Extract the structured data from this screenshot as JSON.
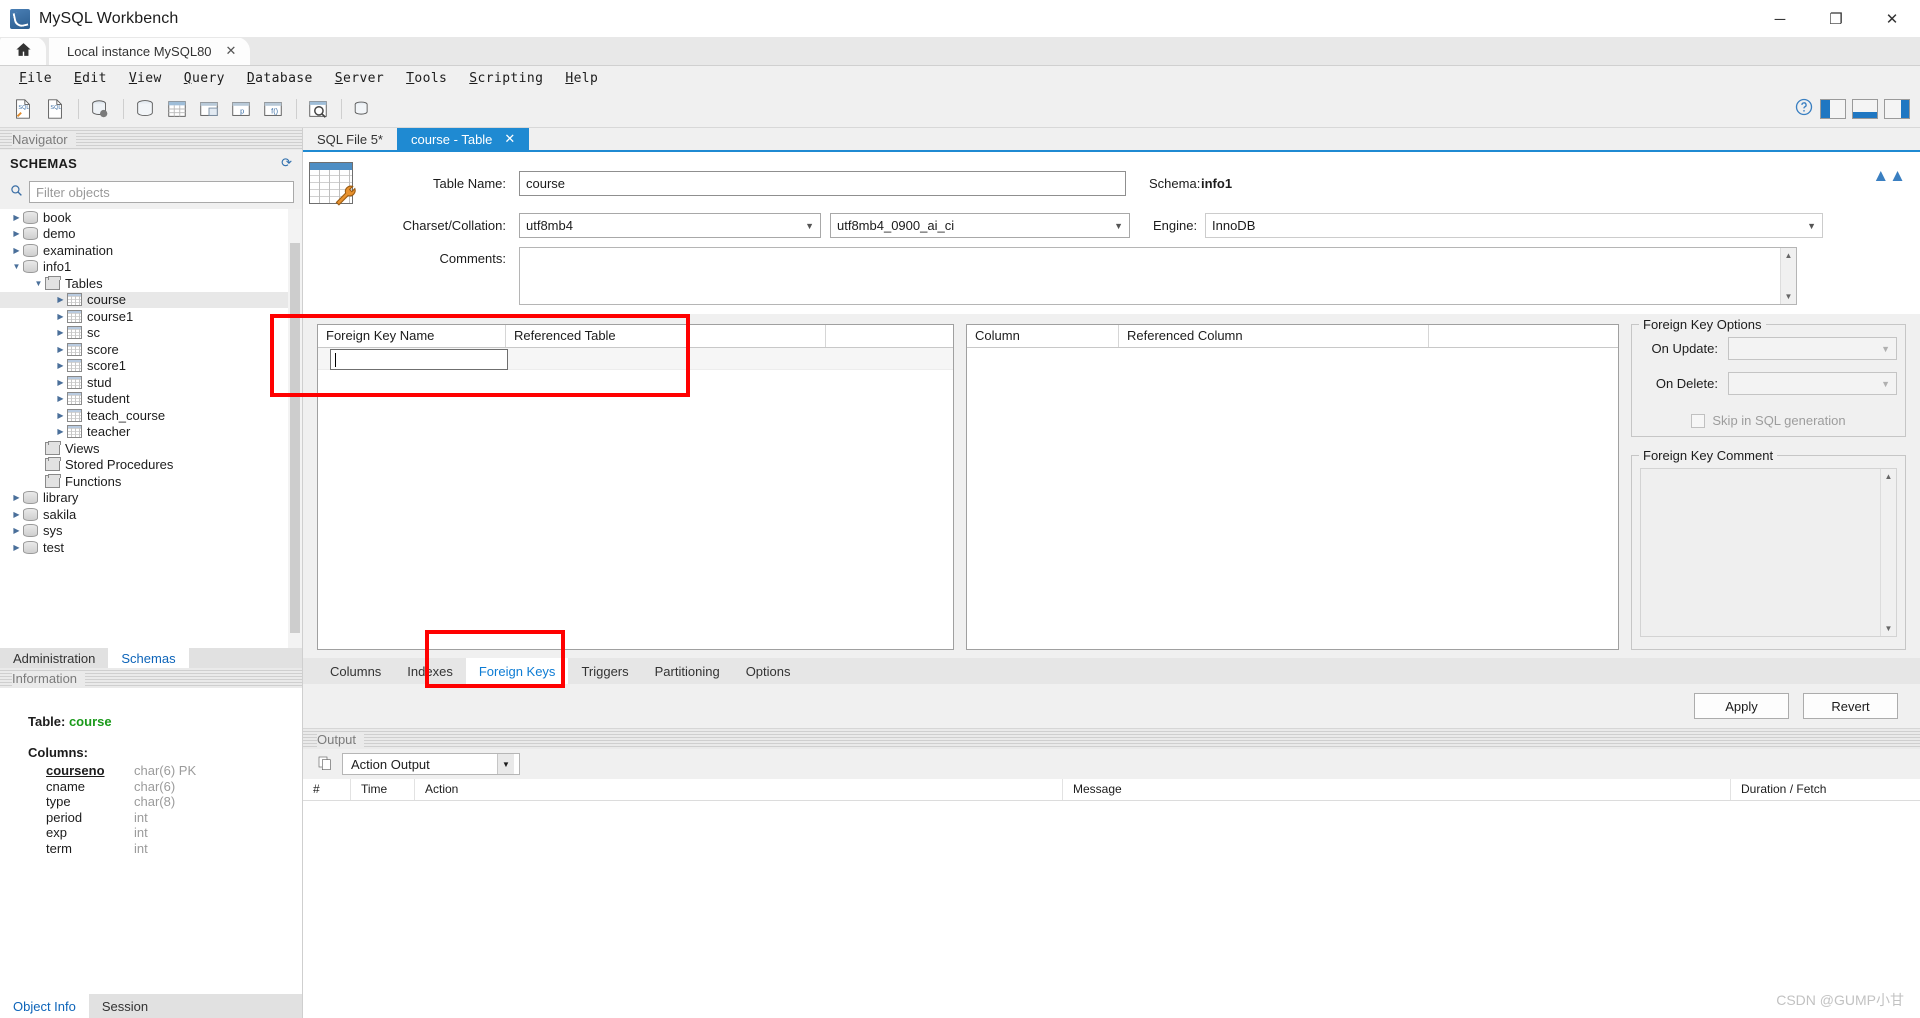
{
  "window": {
    "title": "MySQL Workbench",
    "app_icon": "mysql-dolphin-icon",
    "minimize": "─",
    "maximize": "❐",
    "close": "✕"
  },
  "connection_tabs": {
    "home_icon": "home-icon",
    "tabs": [
      {
        "label": "Local instance MySQL80",
        "close": "✕",
        "active": true
      }
    ]
  },
  "menubar": {
    "items": [
      "File",
      "Edit",
      "View",
      "Query",
      "Database",
      "Server",
      "Tools",
      "Scripting",
      "Help"
    ]
  },
  "toolbar": {
    "buttons": [
      "new-sql-tab-icon",
      "open-sql-script-icon",
      "open-connection-icon",
      "new-schema-icon",
      "new-table-icon",
      "new-view-icon",
      "new-procedure-icon",
      "new-function-icon",
      "search-data-icon",
      "reconnect-server-icon"
    ],
    "right_buttons": [
      "help-icon",
      "sidebar-toggle-icon",
      "output-toggle-icon",
      "secondary-sidebar-toggle-icon"
    ]
  },
  "sidebar": {
    "navigator_title": "Navigator",
    "pin_icon": "pin-icon",
    "schemas_title": "SCHEMAS",
    "refresh_icon": "refresh-icon",
    "filter": {
      "placeholder": "Filter objects",
      "value": "",
      "icon": "search-icon"
    },
    "tree": [
      {
        "label": "book",
        "indent": 0,
        "type": "schema",
        "expanded": false,
        "selected": false
      },
      {
        "label": "demo",
        "indent": 0,
        "type": "schema",
        "expanded": false,
        "selected": false
      },
      {
        "label": "examination",
        "indent": 0,
        "type": "schema",
        "expanded": false,
        "selected": false
      },
      {
        "label": "info1",
        "indent": 0,
        "type": "schema",
        "expanded": true,
        "selected": false
      },
      {
        "label": "Tables",
        "indent": 1,
        "type": "group",
        "expanded": true,
        "selected": false
      },
      {
        "label": "course",
        "indent": 2,
        "type": "table",
        "expanded": false,
        "selected": true
      },
      {
        "label": "course1",
        "indent": 2,
        "type": "table",
        "expanded": false,
        "selected": false
      },
      {
        "label": "sc",
        "indent": 2,
        "type": "table",
        "expanded": false,
        "selected": false
      },
      {
        "label": "score",
        "indent": 2,
        "type": "table",
        "expanded": false,
        "selected": false
      },
      {
        "label": "score1",
        "indent": 2,
        "type": "table",
        "expanded": false,
        "selected": false
      },
      {
        "label": "stud",
        "indent": 2,
        "type": "table",
        "expanded": false,
        "selected": false
      },
      {
        "label": "student",
        "indent": 2,
        "type": "table",
        "expanded": false,
        "selected": false
      },
      {
        "label": "teach_course",
        "indent": 2,
        "type": "table",
        "expanded": false,
        "selected": false
      },
      {
        "label": "teacher",
        "indent": 2,
        "type": "table",
        "expanded": false,
        "selected": false
      },
      {
        "label": "Views",
        "indent": 1,
        "type": "group",
        "expanded": null,
        "selected": false
      },
      {
        "label": "Stored Procedures",
        "indent": 1,
        "type": "group",
        "expanded": null,
        "selected": false
      },
      {
        "label": "Functions",
        "indent": 1,
        "type": "group",
        "expanded": null,
        "selected": false
      },
      {
        "label": "library",
        "indent": 0,
        "type": "schema",
        "expanded": false,
        "selected": false
      },
      {
        "label": "sakila",
        "indent": 0,
        "type": "schema",
        "expanded": false,
        "selected": false
      },
      {
        "label": "sys",
        "indent": 0,
        "type": "schema",
        "expanded": false,
        "selected": false
      },
      {
        "label": "test",
        "indent": 0,
        "type": "schema",
        "expanded": false,
        "selected": false
      }
    ],
    "panel_tabs": [
      {
        "label": "Administration",
        "active": false
      },
      {
        "label": "Schemas",
        "active": true
      }
    ],
    "information_title": "Information",
    "info": {
      "table_label": "Table:",
      "table_name": "course",
      "columns_label": "Columns:",
      "columns": [
        {
          "name": "courseno",
          "type": "char(6) PK",
          "pk": true
        },
        {
          "name": "cname",
          "type": "char(6)",
          "pk": false
        },
        {
          "name": "type",
          "type": "char(8)",
          "pk": false
        },
        {
          "name": "period",
          "type": "int",
          "pk": false
        },
        {
          "name": "exp",
          "type": "int",
          "pk": false
        },
        {
          "name": "term",
          "type": "int",
          "pk": false
        }
      ]
    },
    "footer_tabs": [
      {
        "label": "Object Info",
        "active": true
      },
      {
        "label": "Session",
        "active": false
      }
    ]
  },
  "editor": {
    "tabs": [
      {
        "label": "SQL File 5*",
        "active": false,
        "closable": false
      },
      {
        "label": "course - Table",
        "active": true,
        "closable": true,
        "close": "✕"
      }
    ],
    "table_icon": "table-edit-icon",
    "collapse_icon": "collapse-chevrons-icon",
    "fields": {
      "table_name_label": "Table Name:",
      "table_name_value": "course",
      "schema_label": "Schema:",
      "schema_value": "info1",
      "charset_label": "Charset/Collation:",
      "charset_value": "utf8mb4",
      "collation_value": "utf8mb4_0900_ai_ci",
      "engine_label": "Engine:",
      "engine_value": "InnoDB",
      "comments_label": "Comments:",
      "comments_value": ""
    }
  },
  "foreign_keys": {
    "left_grid": {
      "headers": [
        "Foreign Key Name",
        "Referenced Table"
      ],
      "editing_row_value": "",
      "rows": []
    },
    "right_grid": {
      "headers": [
        "Column",
        "Referenced Column"
      ],
      "rows": []
    },
    "options": {
      "group_title": "Foreign Key Options",
      "on_update_label": "On Update:",
      "on_update_value": "",
      "on_delete_label": "On Delete:",
      "on_delete_value": "",
      "skip_label": "Skip in SQL generation",
      "skip_checked": false,
      "comment_group_title": "Foreign Key Comment",
      "comment_value": ""
    }
  },
  "bottom_tabs": [
    {
      "label": "Columns",
      "active": false
    },
    {
      "label": "Indexes",
      "active": false
    },
    {
      "label": "Foreign Keys",
      "active": true
    },
    {
      "label": "Triggers",
      "active": false
    },
    {
      "label": "Partitioning",
      "active": false
    },
    {
      "label": "Options",
      "active": false
    }
  ],
  "actions": {
    "apply": "Apply",
    "revert": "Revert"
  },
  "output": {
    "title": "Output",
    "copy_icon": "copy-icon",
    "selected_view": "Action Output",
    "columns": [
      "#",
      "Time",
      "Action",
      "Message",
      "Duration / Fetch"
    ],
    "rows": []
  },
  "annotations": {
    "highlight_color": "#ff0000",
    "boxes": [
      "foreign-key-name-field-highlight",
      "foreign-keys-tab-highlight"
    ]
  },
  "watermark": "CSDN @GUMP小甘"
}
